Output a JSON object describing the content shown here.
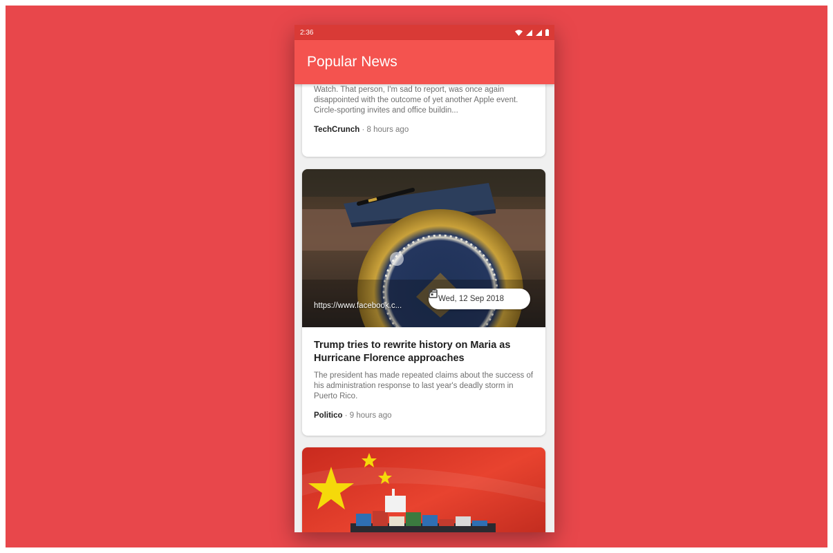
{
  "status_bar": {
    "time": "2:36"
  },
  "app_bar": {
    "title": "Popular News"
  },
  "articles": [
    {
      "description": "Watch. That person, I'm sad to report, was once again disappointed with the outcome of yet another Apple event. Circle-sporting invites and office buildin...",
      "source": "TechCrunch",
      "time_ago": "· 8 hours ago"
    },
    {
      "image_caption": "https://www.facebook.c...",
      "date": "Wed, 12 Sep 2018",
      "title": "Trump tries to rewrite history on Maria as Hurricane Florence approaches",
      "description": "The president has made repeated claims about the success of his administration response to last year's deadly storm in Puerto Rico.",
      "source": "Politico",
      "time_ago": "· 9 hours ago"
    },
    {
      "image_subject": "china-flag-cargo-ship"
    }
  ],
  "icons": {
    "wifi": "wifi-icon",
    "signal": "signal-icon",
    "battery": "battery-icon",
    "calendar": "calendar-icon"
  },
  "colors": {
    "background": "#e8474b",
    "status_bar": "#d93a36",
    "app_bar": "#f4534f",
    "card": "#ffffff"
  }
}
